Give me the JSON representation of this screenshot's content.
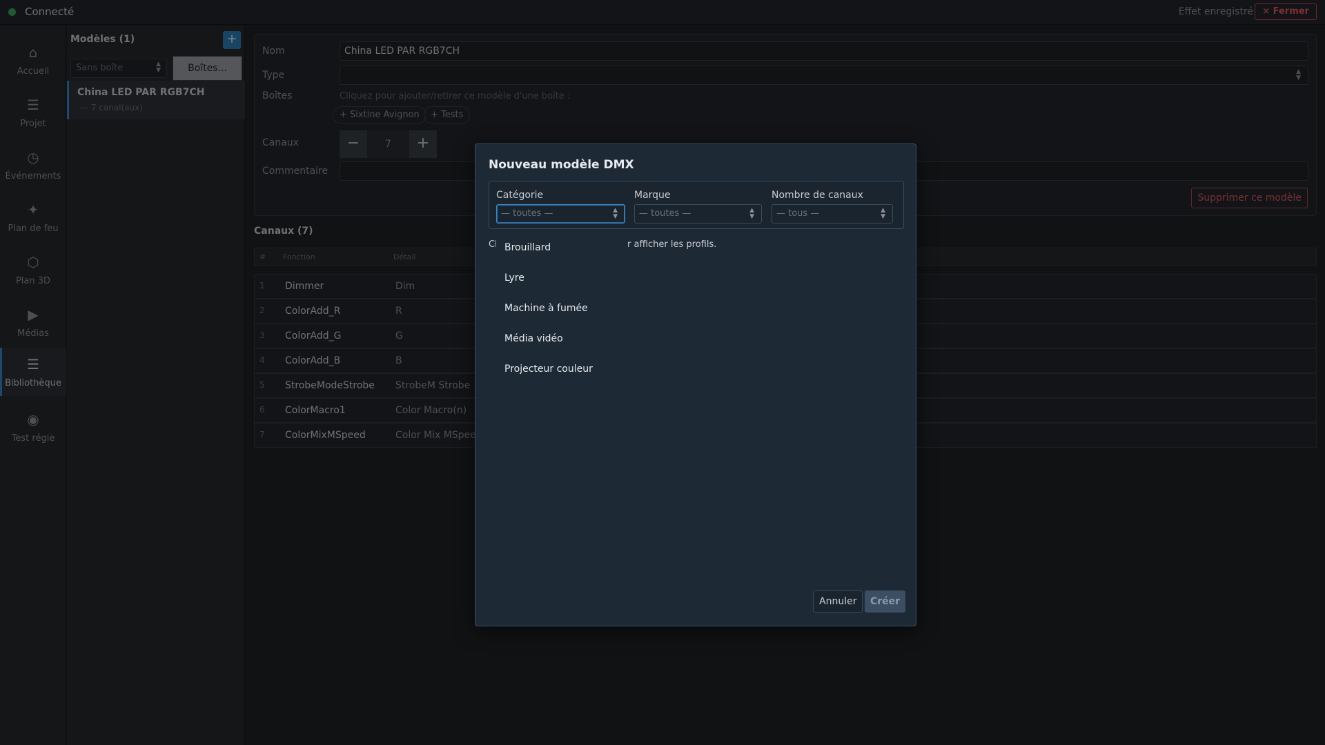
{
  "topbar": {
    "status": "Connecté",
    "saved_status": "Effet enregistré",
    "close_label": "× Fermer"
  },
  "nav": [
    {
      "label": "Accueil",
      "icon": "home-icon",
      "glyph": "⌂"
    },
    {
      "label": "Projet",
      "icon": "list-icon",
      "glyph": "☰"
    },
    {
      "label": "Événements",
      "icon": "clock-icon",
      "glyph": "◷"
    },
    {
      "label": "Plan de feu",
      "icon": "sparkle-icon",
      "glyph": "✦"
    },
    {
      "label": "Plan 3D",
      "icon": "cube-icon",
      "glyph": "⬡"
    },
    {
      "label": "Médias",
      "icon": "play-icon",
      "glyph": "▶"
    },
    {
      "label": "Bibliothèque",
      "icon": "library-icon",
      "glyph": "☰"
    },
    {
      "label": "Test régie",
      "icon": "target-icon",
      "glyph": "◉"
    }
  ],
  "models": {
    "title": "Modèles (1)",
    "add_label": "+",
    "filter_placeholder": "Sans boîte",
    "boxes_button": "Boîtes...",
    "items": [
      {
        "name": "China LED PAR RGB7CH",
        "sub": "— 7 canal(aux)"
      }
    ]
  },
  "form": {
    "name_label": "Nom",
    "name_value": "China LED PAR RGB7CH",
    "type_label": "Type",
    "type_value": "",
    "boxes_label": "Boîtes",
    "boxes_hint": "Cliquez pour ajouter/retirer ce modèle d'une boîte :",
    "chips": [
      "+ Sixtine Avignon",
      "+ Tests"
    ],
    "channels_label": "Canaux",
    "channels_value": "7",
    "minus": "−",
    "plus": "+",
    "comment_label": "Commentaire",
    "comment_value": "",
    "delete_label": "Supprimer ce modèle"
  },
  "channels": {
    "title": "Canaux (7)",
    "headers": [
      "#",
      "Fonction",
      "Détail"
    ],
    "rows": [
      {
        "num": "1",
        "fn": "Dimmer",
        "detail": "Dim"
      },
      {
        "num": "2",
        "fn": "ColorAdd_R",
        "detail": "R"
      },
      {
        "num": "3",
        "fn": "ColorAdd_G",
        "detail": "G"
      },
      {
        "num": "4",
        "fn": "ColorAdd_B",
        "detail": "B"
      },
      {
        "num": "5",
        "fn": "StrobeModeStrobe",
        "detail": "StrobeM Strobe"
      },
      {
        "num": "6",
        "fn": "ColorMacro1",
        "detail": "Color Macro(n)"
      },
      {
        "num": "7",
        "fn": "ColorMixMSpeed",
        "detail": "Color Mix MSpeed"
      }
    ]
  },
  "modal": {
    "title": "Nouveau modèle DMX",
    "category_label": "Catégorie",
    "category_value": "— toutes —",
    "brand_label": "Marque",
    "brand_value": "— toutes —",
    "channels_label": "Nombre de canaux",
    "channels_value": "— tous —",
    "prompt_start": "Cł",
    "prompt_end": "r afficher les profils.",
    "dropdown_options": [
      "Brouillard",
      "Lyre",
      "Machine à fumée",
      "Média vidéo",
      "Projecteur couleur"
    ],
    "cancel_label": "Annuler",
    "create_label": "Créer"
  }
}
